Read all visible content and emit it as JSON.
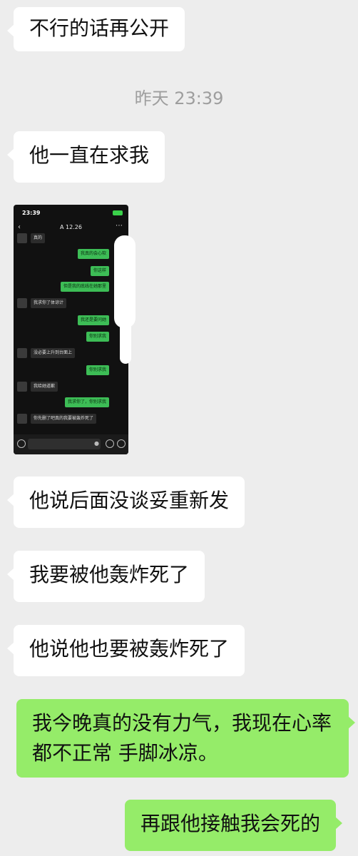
{
  "timestamp": "昨天 23:39",
  "messages": {
    "m1": "不行的话再公开",
    "m2": "他一直在求我",
    "m3": "他说后面没谈妥重新发",
    "m4": "我要被他轰炸死了",
    "m5": "他说他也要被轰炸死了",
    "m6": "我今晚真的没有力气，我现在心率都不正常 手脚冰凉。",
    "m7": "再跟他接触我会死的"
  },
  "embedded_screenshot": {
    "status_time": "23:39",
    "chat_title": "A 12.26",
    "messages": [
      {
        "side": "left",
        "text": "真的"
      },
      {
        "side": "right",
        "text": "我真的会心软"
      },
      {
        "side": "right",
        "text": "你这样"
      },
      {
        "side": "right",
        "text": "但是我的底线在她那里"
      },
      {
        "side": "left",
        "text": "我求你了体谅计"
      },
      {
        "side": "right",
        "text": "我还是要问她"
      },
      {
        "side": "right",
        "text": "你别求我"
      },
      {
        "side": "left",
        "text": "没必要上升到台面上"
      },
      {
        "side": "right",
        "text": "你别求我"
      },
      {
        "side": "left",
        "text": "我给她道歉"
      },
      {
        "side": "right",
        "text": "我求你了，你别求我"
      },
      {
        "side": "left",
        "text": "你先删了吧真的我要被轰炸死了"
      }
    ]
  },
  "colors": {
    "background": "#ededed",
    "incoming_bubble": "#ffffff",
    "outgoing_bubble": "#95ec69"
  }
}
